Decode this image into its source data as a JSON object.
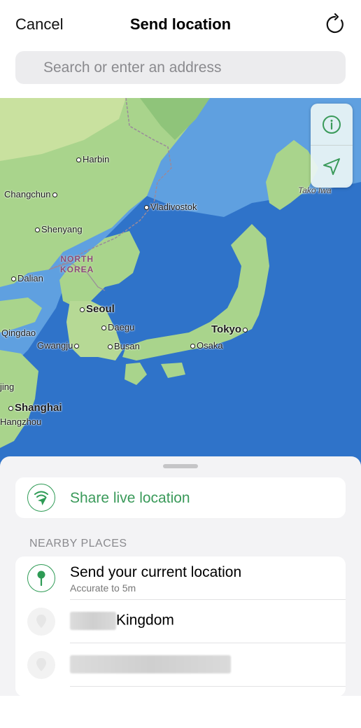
{
  "header": {
    "cancel_label": "Cancel",
    "title": "Send location"
  },
  "search": {
    "placeholder": "Search or enter an address"
  },
  "map": {
    "labels": {
      "harbin": "Harbin",
      "changchun": "Changchun",
      "vladivostok": "Vladivostok",
      "shenyang": "Shenyang",
      "north_korea_1": "NORTH",
      "north_korea_2": "KOREA",
      "dalian": "Dalian",
      "seoul": "Seoul",
      "qingdao": "Qingdao",
      "daegu": "Daegu",
      "gwangju": "Gwangju",
      "busan": "Busan",
      "tokyo": "Tokyo",
      "osaka": "Osaka",
      "shanghai": "Shanghai",
      "hangzhou": "Hangzhou",
      "jing": "jing",
      "tako_iwa": "Tako Iwa"
    },
    "colors": {
      "land": "#a9d48c",
      "sea": "#2f73c9",
      "shallow": "#5fa0e0"
    }
  },
  "sheet": {
    "share_live_label": "Share live location",
    "section_title": "NEARBY PLACES",
    "current": {
      "title": "Send your current location",
      "subtitle": "Accurate to 5m"
    },
    "places": [
      {
        "name": "Kingdom"
      }
    ]
  },
  "accent_color": "#3a9a5a"
}
